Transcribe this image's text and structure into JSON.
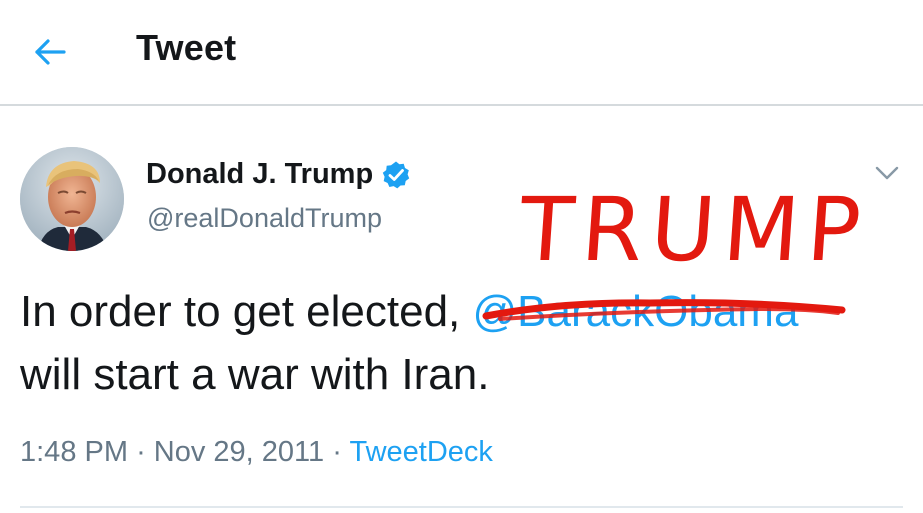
{
  "header": {
    "title": "Tweet",
    "back_icon": "arrow-left-icon"
  },
  "colors": {
    "accent": "#1da1f2",
    "annotation": "#e3190f",
    "text": "#14171a",
    "muted": "#657786"
  },
  "tweet": {
    "author_name": "Donald J. Trump",
    "author_handle": "@realDonaldTrump",
    "verified": true,
    "text_before": "In order to get elected,",
    "mention": "@BarackObama",
    "text_after": "will start a war with Iran.",
    "time": "1:48 PM",
    "date": "Nov 29, 2011",
    "separator": "·",
    "source": "TweetDeck"
  },
  "annotation": {
    "handwritten_replacement": "TRUMP",
    "strikethrough_target": "@BarackObama"
  }
}
